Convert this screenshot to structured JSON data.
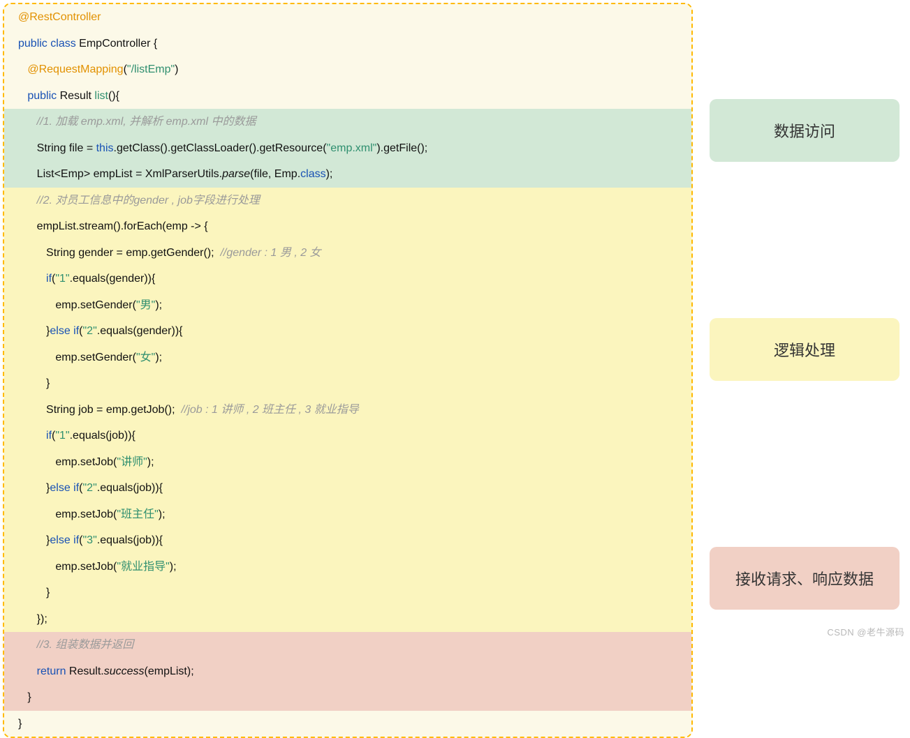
{
  "code": {
    "l01": "@RestController",
    "l02a": "public",
    "l02b": " class",
    "l02c": " EmpController {",
    "l03a": "@RequestMapping",
    "l03b": "(",
    "l03c": "\"/listEmp\"",
    "l03d": ")",
    "l04a": "public",
    "l04b": " Result ",
    "l04c": "list",
    "l04d": "(){",
    "l05": "//1. 加载 emp.xml, 并解析 emp.xml 中的数据",
    "l06a": "String file = ",
    "l06b": "this",
    "l06c": ".getClass().getClassLoader().getResource(",
    "l06d": "\"emp.xml\"",
    "l06e": ").getFile();",
    "l07a": "List<Emp> empList = XmlParserUtils.",
    "l07b": "parse",
    "l07c": "(file, Emp.",
    "l07d": "class",
    "l07e": ");",
    "l08": "//2. 对员工信息中的gender , job字段进行处理",
    "l09": "empList.stream().forEach(emp -> {",
    "l10a": "String gender = emp.getGender();  ",
    "l10b": "//gender : 1 男 , 2 女",
    "l11a": "if",
    "l11b": "(",
    "l11c": "\"1\"",
    "l11d": ".equals(gender)){",
    "l12a": "emp.setGender(",
    "l12b": "\"男\"",
    "l12c": ");",
    "l13a": "}",
    "l13b": "else if",
    "l13c": "(",
    "l13d": "\"2\"",
    "l13e": ".equals(gender)){",
    "l14a": "emp.setGender(",
    "l14b": "\"女\"",
    "l14c": ");",
    "l15": "}",
    "l16a": "String job = emp.getJob();  ",
    "l16b": "//job : 1 讲师 , 2 班主任 , 3 就业指导",
    "l17a": "if",
    "l17b": "(",
    "l17c": "\"1\"",
    "l17d": ".equals(job)){",
    "l18a": "emp.setJob(",
    "l18b": "\"讲师\"",
    "l18c": ");",
    "l19a": "}",
    "l19b": "else if",
    "l19c": "(",
    "l19d": "\"2\"",
    "l19e": ".equals(job)){",
    "l20a": "emp.setJob(",
    "l20b": "\"班主任\"",
    "l20c": ");",
    "l21a": "}",
    "l21b": "else if",
    "l21c": "(",
    "l21d": "\"3\"",
    "l21e": ".equals(job)){",
    "l22a": "emp.setJob(",
    "l22b": "\"就业指导\"",
    "l22c": ");",
    "l23": "}",
    "l24": "});",
    "l25": "//3. 组装数据并返回",
    "l26a": "return",
    "l26b": " Result.",
    "l26c": "success",
    "l26d": "(empList);",
    "l27": "}",
    "l28": "}"
  },
  "labels": {
    "data_access": "数据访问",
    "logic": "逻辑处理",
    "response": "接收请求、响应数据"
  },
  "watermark": "CSDN @老牛源码"
}
